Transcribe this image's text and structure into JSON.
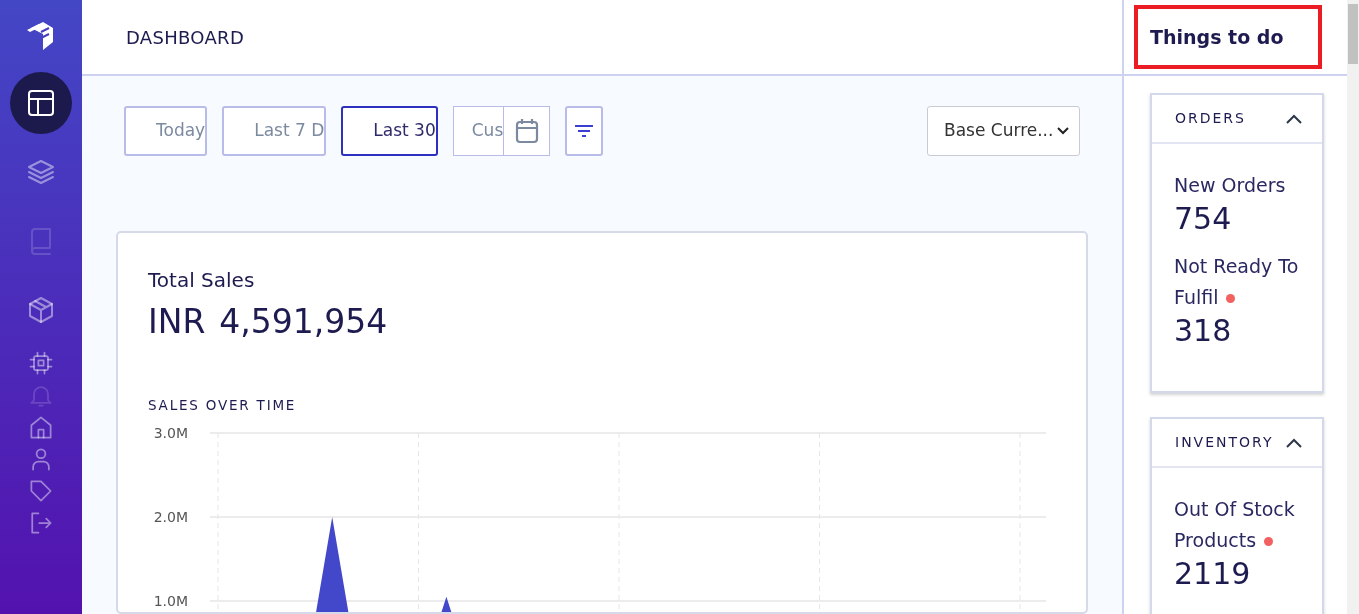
{
  "sidebar": {
    "items": [
      {
        "selected": true,
        "disabled": false
      },
      {
        "selected": false,
        "disabled": false
      },
      {
        "selected": false,
        "disabled": true
      },
      {
        "selected": false,
        "disabled": false
      },
      {
        "selected": false,
        "disabled": false
      },
      {
        "selected": false,
        "disabled": true
      },
      {
        "selected": false,
        "disabled": false
      },
      {
        "selected": false,
        "disabled": false
      },
      {
        "selected": false,
        "disabled": false
      },
      {
        "selected": false,
        "disabled": false
      }
    ]
  },
  "header": {
    "title": "DASHBOARD"
  },
  "date_ranges": [
    {
      "label": "Today",
      "selected": false
    },
    {
      "label": "Last 7 D",
      "selected": false
    },
    {
      "label": "Last 30",
      "selected": true
    },
    {
      "label": "Cus",
      "selected": false,
      "kind": "custom"
    }
  ],
  "currency_select": {
    "value": "Base Curre..."
  },
  "sales_card": {
    "title": "Total Sales",
    "currency": "INR",
    "amount": "4,591,954",
    "chart_title": "SALES OVER TIME",
    "chart_data": {
      "type": "area",
      "grid": true,
      "yticks": [
        {
          "value": 1000000,
          "label": "1.0M"
        },
        {
          "value": 2000000,
          "label": "2.0M"
        },
        {
          "value": 3000000,
          "label": "3.0M"
        }
      ],
      "ylim": [
        0,
        3000000
      ],
      "series": [
        {
          "color": "#4347c9",
          "values": [
            0,
            0,
            0,
            0,
            2000000,
            0,
            0,
            0,
            1050000,
            0,
            0,
            0,
            0,
            0,
            0,
            0,
            0,
            0,
            0,
            0,
            0,
            0,
            0,
            0,
            0,
            0,
            0,
            0,
            0,
            0
          ]
        }
      ]
    }
  },
  "todo_panel": {
    "title": "Things to do",
    "highlighted": true,
    "sections": [
      {
        "title": "ORDERS",
        "expanded": true,
        "metrics": [
          {
            "label": "New Orders",
            "value": "754",
            "alert": false
          },
          {
            "label": "Not Ready To Fulfil",
            "value": "318",
            "alert": true
          }
        ]
      },
      {
        "title": "INVENTORY",
        "expanded": true,
        "metrics": [
          {
            "label": "Out Of Stock Products",
            "value": "2119",
            "alert": true
          }
        ]
      }
    ]
  }
}
